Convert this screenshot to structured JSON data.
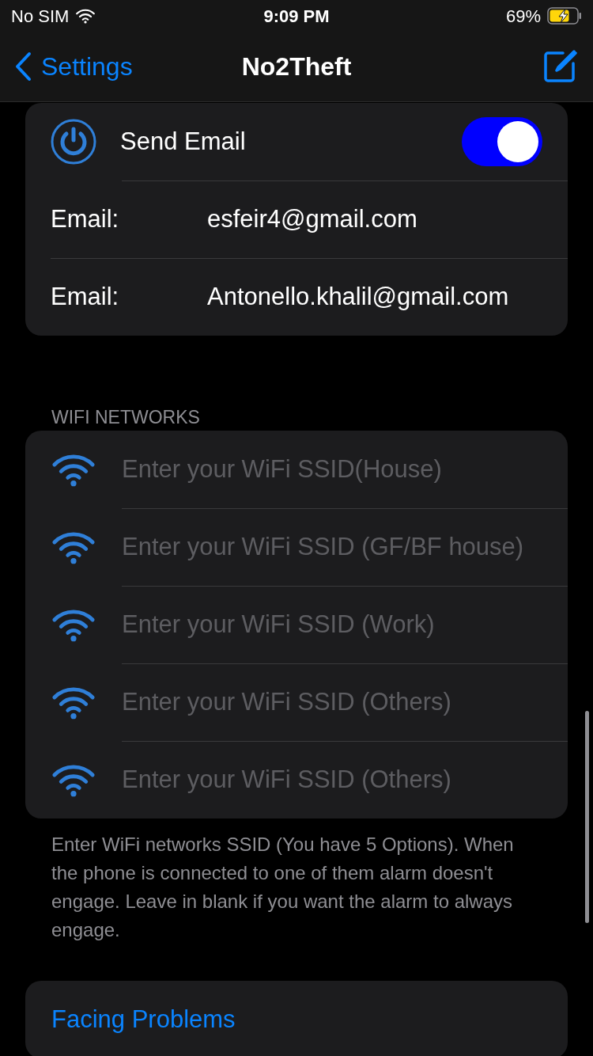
{
  "status_bar": {
    "carrier": "No SIM",
    "time": "9:09 PM",
    "battery": "69%"
  },
  "nav": {
    "back": "Settings",
    "title": "No2Theft"
  },
  "email_section": {
    "toggle": {
      "label": "Send Email",
      "on": true
    },
    "fields": [
      {
        "label": "Email:",
        "value": "esfeir4@gmail.com"
      },
      {
        "label": "Email:",
        "value": "Antonello.khalil@gmail.com"
      }
    ]
  },
  "wifi_section": {
    "header": "WIFI NETWORKS",
    "fields": [
      {
        "placeholder": "Enter your WiFi SSID(House)"
      },
      {
        "placeholder": "Enter your WiFi SSID (GF/BF house)"
      },
      {
        "placeholder": "Enter your WiFi SSID (Work)"
      },
      {
        "placeholder": "Enter your WiFi SSID (Others)"
      },
      {
        "placeholder": "Enter your WiFi SSID (Others)"
      }
    ],
    "footer": "Enter WiFi networks SSID (You have 5 Options). When the phone is connected to one of them alarm doesn't engage. Leave in blank if you want the alarm to always engage."
  },
  "link": "Facing Problems"
}
